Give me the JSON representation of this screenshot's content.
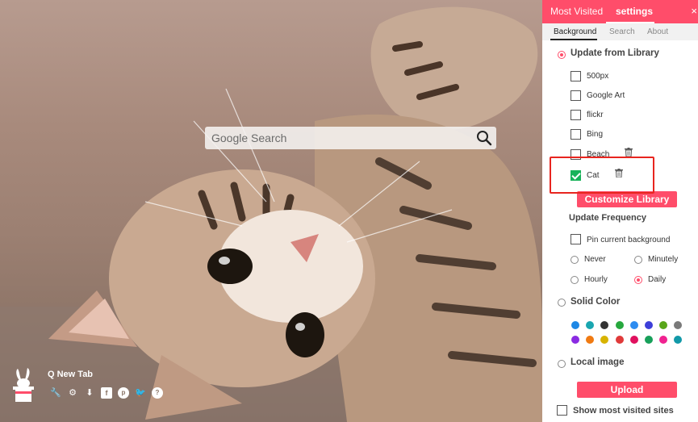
{
  "search": {
    "placeholder": "Google Search"
  },
  "brand": {
    "name": "Q New Tab",
    "icons": [
      "wrench-icon",
      "gear-icon",
      "download-icon",
      "facebook-icon",
      "pinterest-icon",
      "twitter-icon",
      "help-icon"
    ]
  },
  "panel": {
    "tabs": {
      "most_visited": "Most Visited",
      "settings": "settings",
      "close": "×"
    },
    "subtabs": {
      "background": "Background",
      "search": "Search",
      "about": "About"
    },
    "library": {
      "title": "Update from Library",
      "items": [
        {
          "label": "500px",
          "checked": false
        },
        {
          "label": "Google Art",
          "checked": false
        },
        {
          "label": "flickr",
          "checked": false
        },
        {
          "label": "Bing",
          "checked": false
        },
        {
          "label": "Beach",
          "checked": false
        },
        {
          "label": "Cat",
          "checked": true
        }
      ],
      "customize_label": "Customize Library"
    },
    "frequency": {
      "title": "Update Frequency",
      "pin_label": "Pin current background",
      "options": [
        {
          "label": "Never",
          "selected": false
        },
        {
          "label": "Minutely",
          "selected": false
        },
        {
          "label": "Hourly",
          "selected": false
        },
        {
          "label": "Daily",
          "selected": true
        }
      ]
    },
    "solid_color": {
      "title": "Solid Color",
      "colors": [
        "#1e88e5",
        "#1aa6b0",
        "#333333",
        "#27a83e",
        "#2d8cf0",
        "#3d3fd9",
        "#59a61a",
        "#7a7a7a",
        "#8a2be2",
        "#f07a12",
        "#d8b300",
        "#e03a3a",
        "#e0105e",
        "#18a05a",
        "#f02290",
        "#1299a8"
      ]
    },
    "local_image": {
      "title": "Local image",
      "upload_label": "Upload"
    },
    "most_visited_sites": {
      "label": "Show most visited sites"
    },
    "accent_color": "#ff4d6a"
  }
}
